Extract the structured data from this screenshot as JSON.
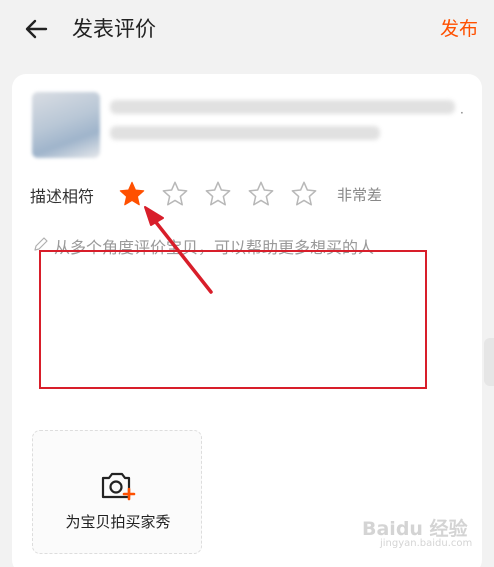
{
  "header": {
    "title": "发表评价",
    "publish_label": "发布"
  },
  "product": {
    "info_blurred": true
  },
  "rating": {
    "label": "描述相符",
    "selected_stars": 1,
    "max_stars": 5,
    "rating_text": "非常差",
    "active_color": "#ff5000",
    "inactive_color": "#b8b8b8"
  },
  "review": {
    "placeholder": "从多个角度评价宝贝，可以帮助更多想买的人"
  },
  "photo": {
    "label": "为宝贝拍买家秀"
  },
  "annotation": {
    "box_color": "#d81e2a",
    "arrow_color": "#d81e2a"
  },
  "watermark": {
    "main": "Baidu 经验",
    "sub": "jingyan.baidu.com"
  }
}
